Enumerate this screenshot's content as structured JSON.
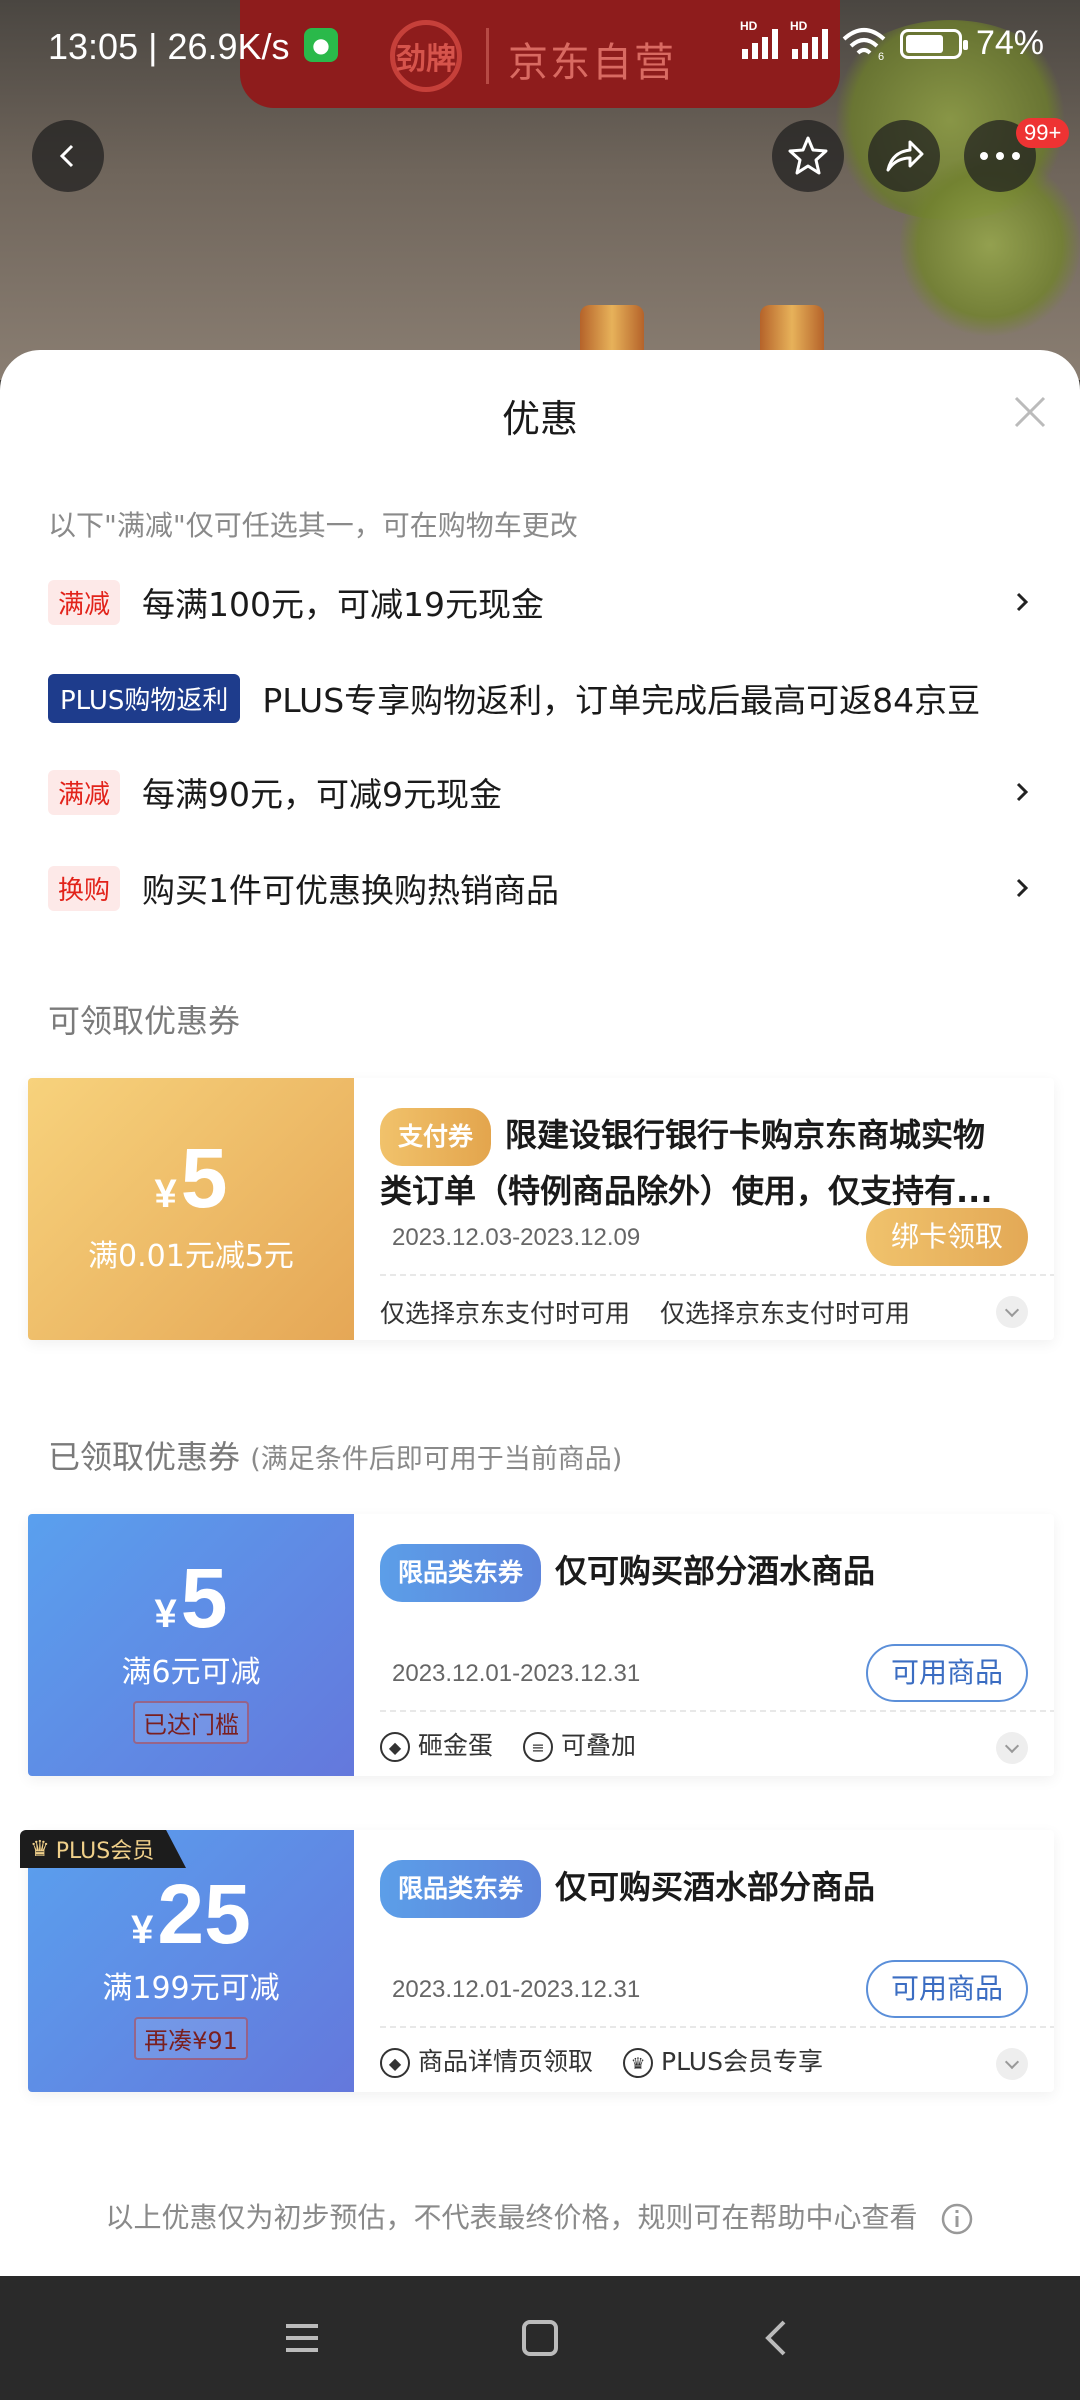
{
  "status_bar": {
    "time": "13:05 | 26.9K/s",
    "battery": "74%",
    "signal_labels": [
      "HD",
      "HD"
    ],
    "wifi_badge": "6"
  },
  "background": {
    "brand_logo_text": "劲牌",
    "brand_text": "京东自营"
  },
  "top_nav": {
    "more_badge": "99+"
  },
  "sheet": {
    "title": "优惠",
    "tip": "以下\"满减\"仅可任选其一，可在购物车更改",
    "promotions": [
      {
        "tag": "满减",
        "text": "每满100元，可减19元现金",
        "arrow": true
      },
      {
        "tag": "PLUS购物返利",
        "text": "PLUS专享购物返利，订单完成后最高可返84京豆",
        "arrow": false
      },
      {
        "tag": "满减",
        "text": "每满90元，可减9元现金",
        "arrow": true
      },
      {
        "tag": "换购",
        "text": "购买1件可优惠换购热销商品",
        "arrow": true
      }
    ],
    "available_section_title": "可领取优惠券",
    "available_coupons": [
      {
        "yen": "¥",
        "amount": "5",
        "condition": "满0.01元减5元",
        "tag": "支付券",
        "title_line1": "限建设银行银行卡购京东商城实物",
        "title_line2": "类订单（特例商品除外）使用，仅支持有...",
        "date": "2023.12.03-2023.12.09",
        "button": "绑卡领取",
        "notes": [
          "仅选择京东支付时可用",
          "仅选择京东支付时可用"
        ]
      }
    ],
    "received_section_title": "已领取优惠券",
    "received_section_sub": "(满足条件后即可用于当前商品)",
    "received_coupons": [
      {
        "yen": "¥",
        "amount": "5",
        "condition": "满6元可减",
        "status": "已达门槛",
        "tag": "限品类东券",
        "title": "仅可购买部分酒水商品",
        "date": "2023.12.01-2023.12.31",
        "button": "可用商品",
        "features": [
          "砸金蛋",
          "可叠加"
        ]
      },
      {
        "plus_badge": "PLUS会员",
        "yen": "¥",
        "amount": "25",
        "condition": "满199元可减",
        "status": "再凑¥91",
        "tag": "限品类东券",
        "title": "仅可购买酒水部分商品",
        "date": "2023.12.01-2023.12.31",
        "button": "可用商品",
        "features": [
          "商品详情页领取",
          "PLUS会员专享"
        ]
      }
    ],
    "footnote": "以上优惠仅为初步预估，不代表最终价格，规则可在帮助中心查看"
  },
  "colors": {
    "tag_red": "#e2231a",
    "gold_coupon": "#e5a756",
    "blue_coupon": "#6478dc",
    "plus_blue": "#1e3c8c"
  }
}
